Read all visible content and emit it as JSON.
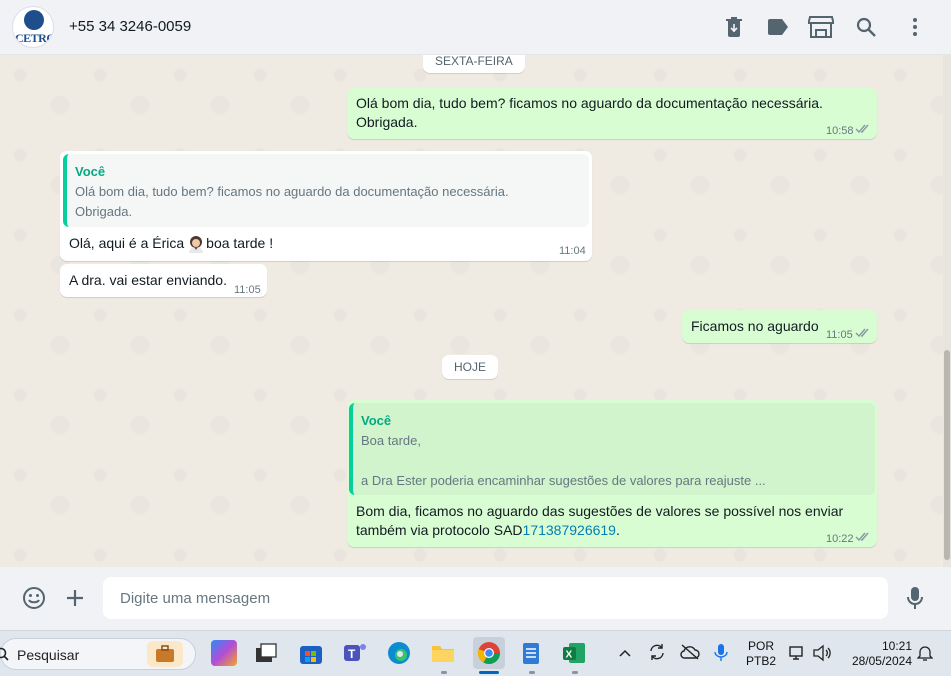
{
  "header": {
    "contact_name": "+55 34 3246-0059",
    "avatar_logo_text": "CETRO",
    "icons": [
      "delete-icon",
      "label-icon",
      "store-icon",
      "search-icon",
      "menu-icon"
    ]
  },
  "chat": {
    "date_chips": [
      "SEXTA-FEIRA",
      "HOJE"
    ],
    "messages": [
      {
        "dir": "out",
        "lines": [
          "Olá bom dia, tudo bem? ficamos no aguardo da documentação necessária.",
          "Obrigada."
        ],
        "time": "10:58",
        "status": "read"
      },
      {
        "dir": "in",
        "quote_author": "Você",
        "quote_lines": [
          "Olá bom dia, tudo bem? ficamos no aguardo da documentação necessária.",
          "Obrigada."
        ],
        "text": "Olá, aqui é a Érica",
        "text_after_emoji": "boa tarde !",
        "time": "11:04"
      },
      {
        "dir": "in",
        "text": "A dra. vai estar enviando.",
        "time": "11:05"
      },
      {
        "dir": "out",
        "text": "Ficamos no aguardo",
        "time": "11:05",
        "status": "read"
      },
      {
        "dir": "out",
        "quote_author": "Você",
        "quote_lines": [
          "Boa tarde,",
          "",
          "a Dra Ester poderia encaminhar sugestões de valores para reajuste ..."
        ],
        "text_line1": "Bom dia, ficamos no aguardo das sugestões de valores  se possível nos enviar",
        "text_line2_prefix": "também via protocolo SAD",
        "text_link": "171387926619",
        "text_line2_suffix": ".",
        "time": "10:22",
        "status": "read"
      }
    ]
  },
  "composer": {
    "placeholder": "Digite uma mensagem",
    "icons": [
      "emoji-icon",
      "plus-icon",
      "microphone-icon"
    ]
  },
  "taskbar": {
    "search_placeholder": "Pesquisar",
    "language": "POR",
    "keyboard": "PTB2",
    "time": "10:21",
    "date": "28/05/2024"
  },
  "colors": {
    "outgoing_bubble": "#d9fdd3",
    "incoming_bubble": "#ffffff",
    "read_ticks": "#8696a0",
    "accent": "#06a884",
    "link": "#027eb5"
  }
}
